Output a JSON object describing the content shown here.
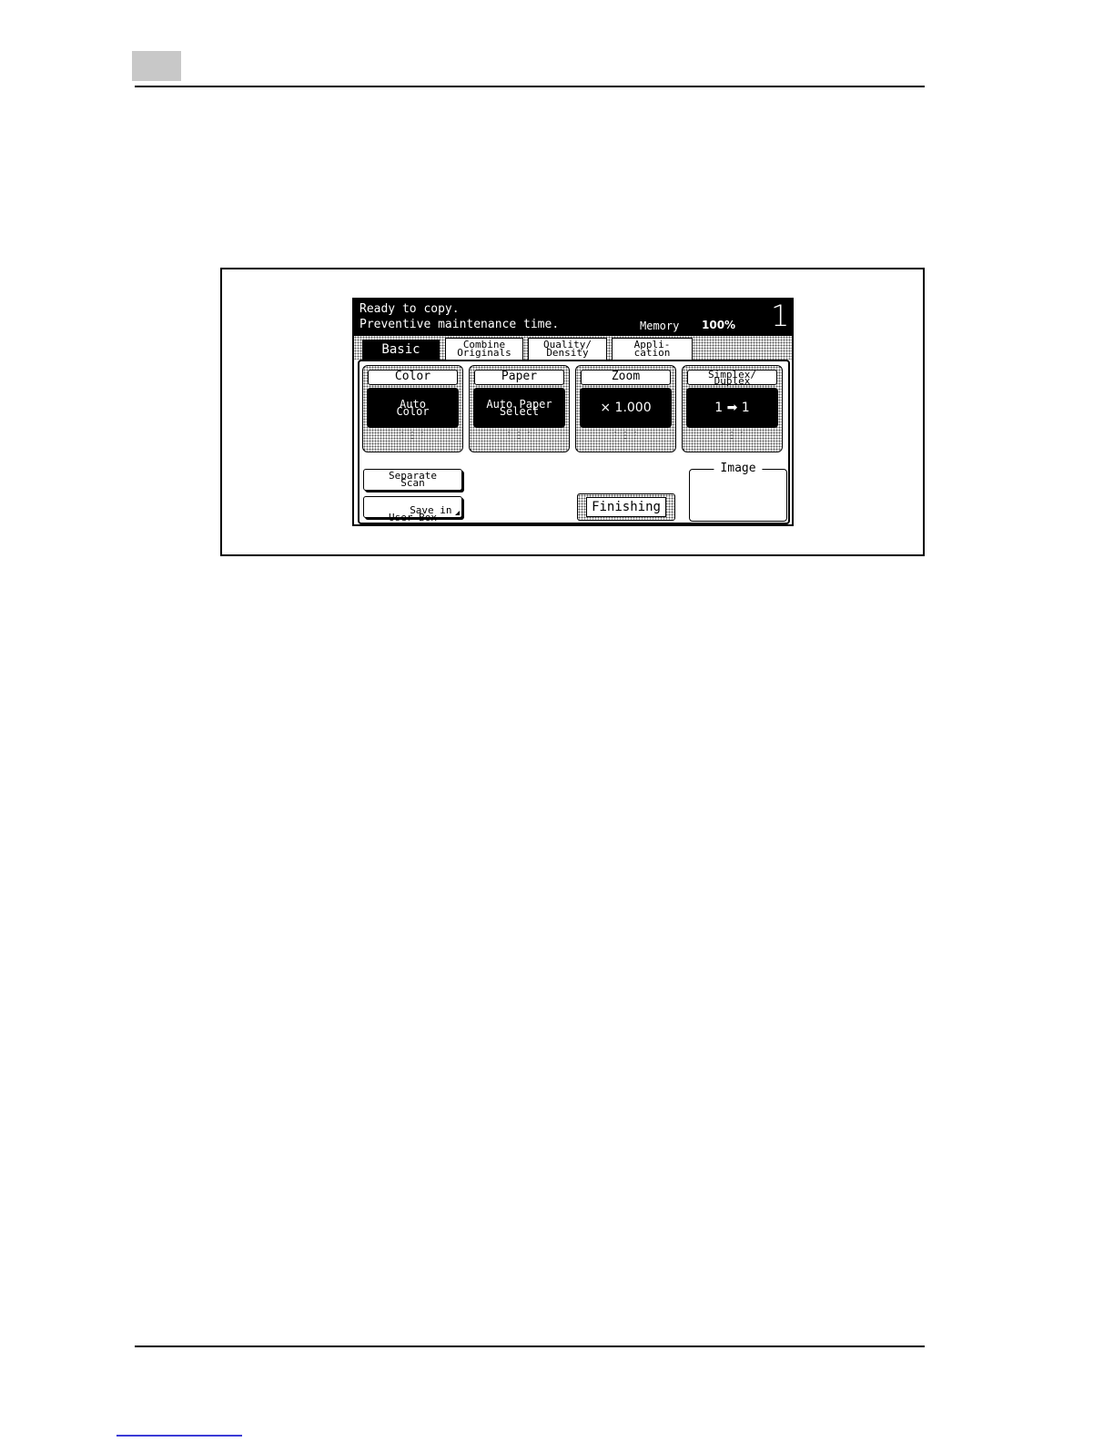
{
  "page": {
    "accent_gray": "#c8c8c8",
    "link_underline_color": "#3b3bd6"
  },
  "screen": {
    "status_line_1": "Ready to copy.",
    "status_line_2": "Preventive maintenance time.",
    "memory_label": "Memory",
    "memory_value": "100%",
    "copy_count": "1",
    "tabs": [
      {
        "label": "Basic",
        "active": true
      },
      {
        "label": "Combine\nOriginals",
        "active": false
      },
      {
        "label": "Quality/\nDensity",
        "active": false
      },
      {
        "label": "Appli-\ncation",
        "active": false
      }
    ],
    "functions": [
      {
        "label": "Color",
        "value": "Auto\nColor"
      },
      {
        "label": "Paper",
        "value": "Auto Paper\nSelect"
      },
      {
        "label": "Zoom",
        "value": "× 1.000"
      },
      {
        "label": "Simplex/\nDuplex",
        "value": "1 ➡ 1"
      }
    ],
    "separate_scan_label": "Separate\nScan",
    "save_in_user_box_label": "Save in\nUser Box",
    "finishing_label": "Finishing",
    "image_label": "Image"
  }
}
